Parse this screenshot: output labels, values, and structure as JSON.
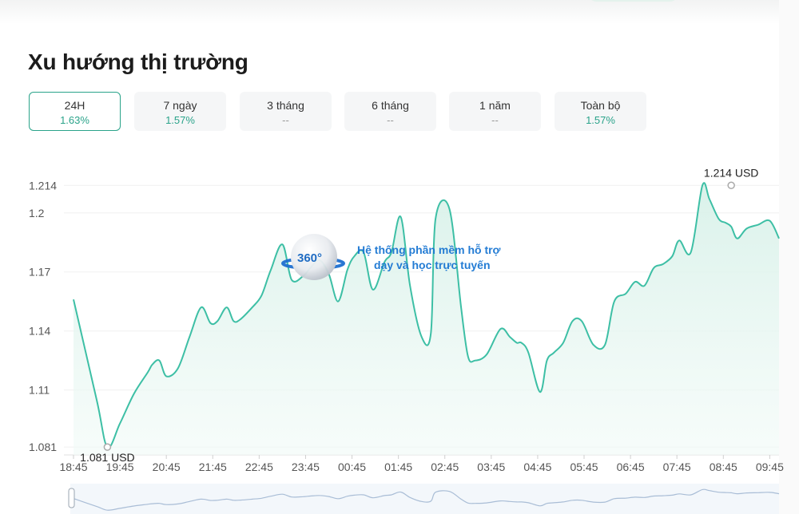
{
  "page": {
    "title": "Xu hướng thị trường"
  },
  "tabs": [
    {
      "label": "24H",
      "value": "1.63%",
      "active": true
    },
    {
      "label": "7 ngày",
      "value": "1.57%",
      "active": false
    },
    {
      "label": "3 tháng",
      "value": "--",
      "active": false
    },
    {
      "label": "6 tháng",
      "value": "--",
      "active": false
    },
    {
      "label": "1 năm",
      "value": "--",
      "active": false
    },
    {
      "label": "Toàn bộ",
      "value": "1.57%",
      "active": false
    }
  ],
  "watermark": {
    "badge": "360°",
    "line1": "Hệ thống phần mềm hỗ trợ",
    "line2": "dạy và học trực tuyến"
  },
  "colors": {
    "accent": "#2aa38a",
    "line": "#3dbfa5",
    "area": "#e3f5ef"
  },
  "chart_data": {
    "type": "area",
    "title": "",
    "xlabel": "",
    "ylabel": "",
    "unit": "USD",
    "ylim": [
      1.077,
      1.221
    ],
    "xlim_hours": [
      0,
      15.2
    ],
    "y_ticks": [
      1.081,
      1.11,
      1.14,
      1.17,
      1.2,
      1.214
    ],
    "x_ticks": [
      "18:45",
      "19:45",
      "20:45",
      "21:45",
      "22:45",
      "23:45",
      "00:45",
      "01:45",
      "02:45",
      "03:45",
      "04:45",
      "05:45",
      "06:45",
      "07:45",
      "08:45",
      "09:45"
    ],
    "grid": "horizontal",
    "min_point": {
      "x": 0.73,
      "y": 1.081,
      "label": "1.081 USD"
    },
    "max_point": {
      "x": 14.17,
      "y": 1.214,
      "label": "1.214 USD"
    },
    "series": [
      {
        "name": "",
        "x": [
          0,
          0.5,
          0.73,
          1.0,
          1.3,
          1.6,
          1.7,
          1.85,
          2.0,
          2.25,
          2.5,
          2.75,
          2.95,
          3.1,
          3.3,
          3.45,
          3.6,
          3.85,
          4.05,
          4.25,
          4.5,
          4.7,
          4.95,
          5.1,
          5.3,
          5.5,
          5.7,
          5.9,
          6.05,
          6.25,
          6.45,
          6.7,
          6.85,
          7.05,
          7.25,
          7.5,
          7.7,
          7.8,
          8.1,
          8.35,
          8.5,
          8.65,
          8.9,
          9.2,
          9.4,
          9.55,
          9.65,
          9.8,
          10.05,
          10.2,
          10.35,
          10.55,
          10.75,
          10.95,
          11.2,
          11.45,
          11.65,
          11.9,
          12.1,
          12.3,
          12.5,
          12.7,
          12.9,
          13.05,
          13.3,
          13.55,
          13.7,
          13.9,
          14.05,
          14.17,
          14.3,
          14.5,
          14.75,
          15.0,
          15.2
        ],
        "y": [
          1.156,
          1.105,
          1.081,
          1.093,
          1.108,
          1.119,
          1.123,
          1.125,
          1.117,
          1.121,
          1.137,
          1.152,
          1.144,
          1.145,
          1.152,
          1.145,
          1.146,
          1.152,
          1.158,
          1.171,
          1.184,
          1.166,
          1.168,
          1.172,
          1.176,
          1.169,
          1.155,
          1.171,
          1.178,
          1.18,
          1.161,
          1.175,
          1.18,
          1.198,
          1.163,
          1.137,
          1.139,
          1.197,
          1.202,
          1.152,
          1.127,
          1.125,
          1.128,
          1.141,
          1.137,
          1.134,
          1.134,
          1.129,
          1.109,
          1.125,
          1.129,
          1.134,
          1.145,
          1.145,
          1.133,
          1.133,
          1.155,
          1.159,
          1.165,
          1.163,
          1.172,
          1.174,
          1.178,
          1.186,
          1.18,
          1.214,
          1.207,
          1.197,
          1.195,
          1.193,
          1.187,
          1.192,
          1.194,
          1.196,
          1.187
        ]
      }
    ]
  }
}
